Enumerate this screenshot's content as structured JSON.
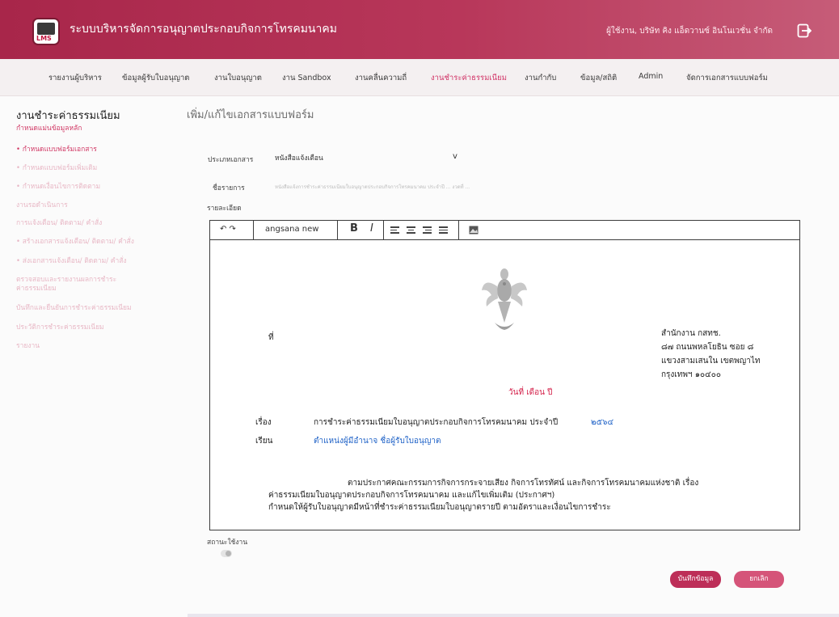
{
  "header": {
    "logo_text": "LMS",
    "app_title": "ระบบบริหารจัดการอนุญาตประกอบกิจการโทรคมนาคม",
    "user_text": "ผู้ใช้งาน, บริษัท คิง แอ็ดวานซ์ อินโนเวชั่น จำกัด",
    "logout_icon": "logout-icon"
  },
  "nav": {
    "items": [
      {
        "label": "รายงานผู้บริหาร"
      },
      {
        "label": "ข้อมูลผู้รับใบอนุญาต"
      },
      {
        "label": "งานใบอนุญาต"
      },
      {
        "label": "งาน Sandbox"
      },
      {
        "label": "งานคลื่นความถี่"
      },
      {
        "label": "งานชำระค่าธรรมเนียม",
        "active": true
      },
      {
        "label": "งานกำกับ"
      },
      {
        "label": "ข้อมูล/สถิติ"
      },
      {
        "label": "Admin"
      },
      {
        "label": "จัดการเอกสารแบบฟอร์ม"
      }
    ]
  },
  "sidebar": {
    "title": "งานชำระค่าธรรมเนียม",
    "items": [
      {
        "label": "กำหนดแม่นข้อมูลหลัก"
      },
      {
        "label": "• กำหนดแบบฟอร์มเอกสาร"
      },
      {
        "label": "• กำหนดแบบฟอร์มเพิ่มเติม"
      },
      {
        "label": "• กำหนดเงื่อนไขการติดตาม"
      },
      {
        "label": "งานรอดำเนินการ"
      },
      {
        "label": "การแจ้งเตือน/ ติดตาม/ คำสั่ง"
      },
      {
        "label": "• สร้างเอกสารแจ้งเตือน/ ติดตาม/ คำสั่ง"
      },
      {
        "label": "• ส่งเอกสารแจ้งเตือน/ ติดตาม/ คำสั่ง"
      },
      {
        "label": "ตรวจสอบและรายงานผลการชำระ"
      },
      {
        "label": "ค่าธรรมเนียม"
      },
      {
        "label": "บันทึกและยืนยันการชำระค่าธรรมเนียม"
      },
      {
        "label": "ประวัติการชำระค่าธรรมเนียม"
      },
      {
        "label": "รายงาน"
      }
    ]
  },
  "form": {
    "title": "เพิ่ม/แก้ไขเอกสารแบบฟอร์ม",
    "doc_type_label": "ประเภทเอกสาร",
    "doc_type_value": "หนังสือแจ้งเตือน",
    "doc_type_caret": "v",
    "name_label": "ชื่อรายการ",
    "name_value": "หนังสือแจ้งการชำระค่าธรรมเนียมใบอนุญาตประกอบกิจการโทรคมนาคม ประจำปี ... งวดที่ ...",
    "detail_label": "รายละเอียด",
    "status_label": "สถานะใช้งาน"
  },
  "editor": {
    "undo_redo": "↶ ↷",
    "font_name": "angsana new",
    "bold": "B",
    "italic": "I",
    "image_icon": "image-icon",
    "emblem_icon": "garuda-emblem-icon"
  },
  "letter": {
    "number_label": "ที่",
    "address": [
      "สำนักงาน กสทช.",
      "๘๗ ถนนพหลโยธิน ซอย ๘",
      "แขวงสามเสนใน เขตพญาไท",
      "กรุงเทพฯ ๑๐๔๐๐"
    ],
    "date_line": "วันที่ เดือน ปี",
    "subject_label": "เรื่อง",
    "subject_text": "การชำระค่าธรรมเนียมใบอนุญาตประกอบกิจการโทรคมนาคม ประจำปี",
    "subject_year": "๒๕๖๔",
    "to_label": "เรียน",
    "to_text": "ตำแหน่งผู้มีอำนาจ ชื่อผู้รับใบอนุญาต",
    "body_lines": [
      "ตามประกาศคณะกรรมการกิจการกระจายเสียง กิจการโทรทัศน์ และกิจการโทรคมนาคมแห่งชาติ เรื่อง",
      "ค่าธรรมเนียมใบอนุญาตประกอบกิจการโทรคมนาคม และแก้ไขเพิ่มเติม (ประกาศฯ)",
      "กำหนดให้ผู้รับใบอนุญาตมีหน้าที่ชำระค่าธรรมเนียมใบอนุญาตรายปี ตามอัตราและเงื่อนไขการชำระ"
    ]
  },
  "buttons": {
    "save": "บันทึกข้อมูล",
    "cancel": "ยกเลิก"
  },
  "colors": {
    "accent": "#b8375a",
    "active_nav": "#d13366",
    "red_text": "#d4214a",
    "blue_text": "#1f62c7"
  }
}
